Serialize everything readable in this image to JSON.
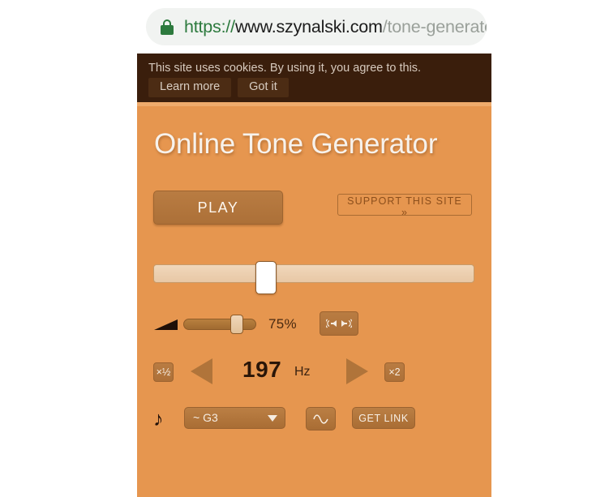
{
  "browser": {
    "url": {
      "scheme": "https://",
      "host": "www.szynalski.com",
      "path": "/tone-generato",
      "lock_icon": "lock-icon",
      "full": "https://www.szynalski.com/tone-generato"
    }
  },
  "cookie_banner": {
    "message": "This site uses cookies. By using it, you agree to this.",
    "learn_more_label": "Learn more",
    "got_it_label": "Got it",
    "background": "#3a1e0c",
    "text_color": "#d6c9bd"
  },
  "page": {
    "title": "Online Tone Generator",
    "background": "#e6964f",
    "accent": "#b0743a"
  },
  "controls": {
    "play_label": "PLAY",
    "support_label": "SUPPORT THIS SITE »",
    "frequency_slider": {
      "name": "frequency-slider",
      "handle_position_percent": 33
    },
    "volume": {
      "icon": "volume-triangle-icon",
      "percent_label": "75%",
      "value": 75,
      "balance_icon": "stereo-balance-icon"
    },
    "frequency": {
      "half_label": "×½",
      "double_label": "×2",
      "decrement_icon": "triangle-left-icon",
      "increment_icon": "triangle-right-icon",
      "value": "197",
      "unit": "Hz"
    },
    "note": {
      "icon": "music-note-icon",
      "selected": "~ G3",
      "caret_icon": "chevron-down-icon"
    },
    "waveform": {
      "icon": "sine-wave-icon"
    },
    "get_link_label": "GET LINK"
  }
}
